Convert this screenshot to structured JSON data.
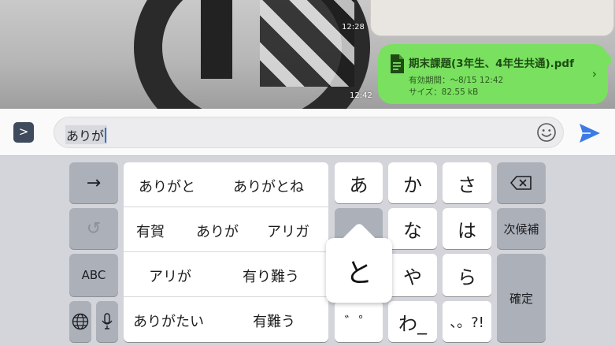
{
  "chat": {
    "timestamp_top": "12:28",
    "timestamp_bottom": "12:42",
    "file": {
      "name": "期末課題(3年生、4年生共通).pdf",
      "expiry": "有効期間：～8/15 12:42",
      "size": "サイズ：82.55 kB",
      "icon": "document-icon",
      "chevron": "›"
    },
    "bubble_color": "#79e15f"
  },
  "input": {
    "expand_glyph": ">",
    "text": "ありが",
    "emoji_icon": "smiley-icon",
    "send_icon": "send-icon",
    "send_color": "#3b7be8"
  },
  "keyboard": {
    "left": {
      "arrow": "→",
      "undo": "↺",
      "abc": "ABC",
      "globe_icon": "globe-icon",
      "mic_icon": "microphone-icon"
    },
    "candidates": [
      [
        "ありがと",
        "ありがとね"
      ],
      [
        "有賀",
        "ありが",
        "アリガ"
      ],
      [
        "アリが",
        "有り難う"
      ],
      [
        "ありがたい",
        "有難う"
      ]
    ],
    "kana": {
      "a": "あ",
      "ka": "か",
      "sa": "さ",
      "na": "な",
      "ha": "は",
      "ya": "や",
      "ra": "ら",
      "dakuten": "゛゜",
      "wa": "わ_",
      "punct": "、。?!"
    },
    "popup": "と",
    "right": {
      "next_candidate": "次候補",
      "confirm": "確定",
      "delete_icon": "backspace-icon"
    }
  }
}
